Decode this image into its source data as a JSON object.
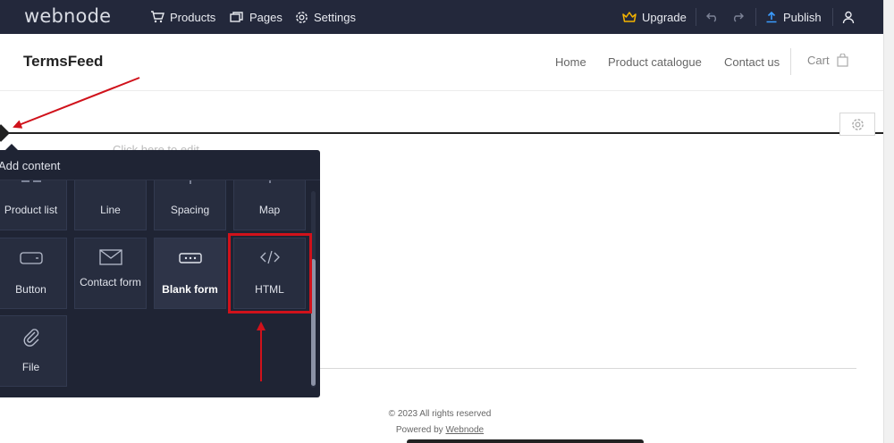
{
  "app": {
    "logo": "webnode",
    "nav": {
      "products": "Products",
      "pages": "Pages",
      "settings": "Settings"
    },
    "upgrade": "Upgrade",
    "publish": "Publish"
  },
  "site": {
    "title": "TermsFeed",
    "nav": {
      "home": "Home",
      "catalogue": "Product catalogue",
      "contact": "Contact us"
    },
    "cart": "Cart",
    "placeholder": "Click here to edit",
    "footer": {
      "copyright": "© 2023 All rights reserved",
      "powered_prefix": "Powered by",
      "powered_link": "Webnode"
    }
  },
  "panel": {
    "title": "Add content",
    "tiles": [
      {
        "label": "Product list",
        "icon": "product-list-icon"
      },
      {
        "label": "Line",
        "icon": "line-icon"
      },
      {
        "label": "Spacing",
        "icon": "spacing-icon"
      },
      {
        "label": "Map",
        "icon": "map-icon"
      },
      {
        "label": "Button",
        "icon": "button-icon"
      },
      {
        "label": "Contact form",
        "icon": "envelope-icon"
      },
      {
        "label": "Blank form",
        "icon": "blank-form-icon"
      },
      {
        "label": "HTML",
        "icon": "code-icon"
      },
      {
        "label": "File",
        "icon": "paperclip-icon"
      }
    ]
  },
  "colors": {
    "topbar": "#23283b",
    "panel": "#1f2434",
    "tile": "#272d3f",
    "upgrade_crown": "#f5b400",
    "publish_icon": "#3b9cff",
    "annotation_red": "#d0121b"
  }
}
